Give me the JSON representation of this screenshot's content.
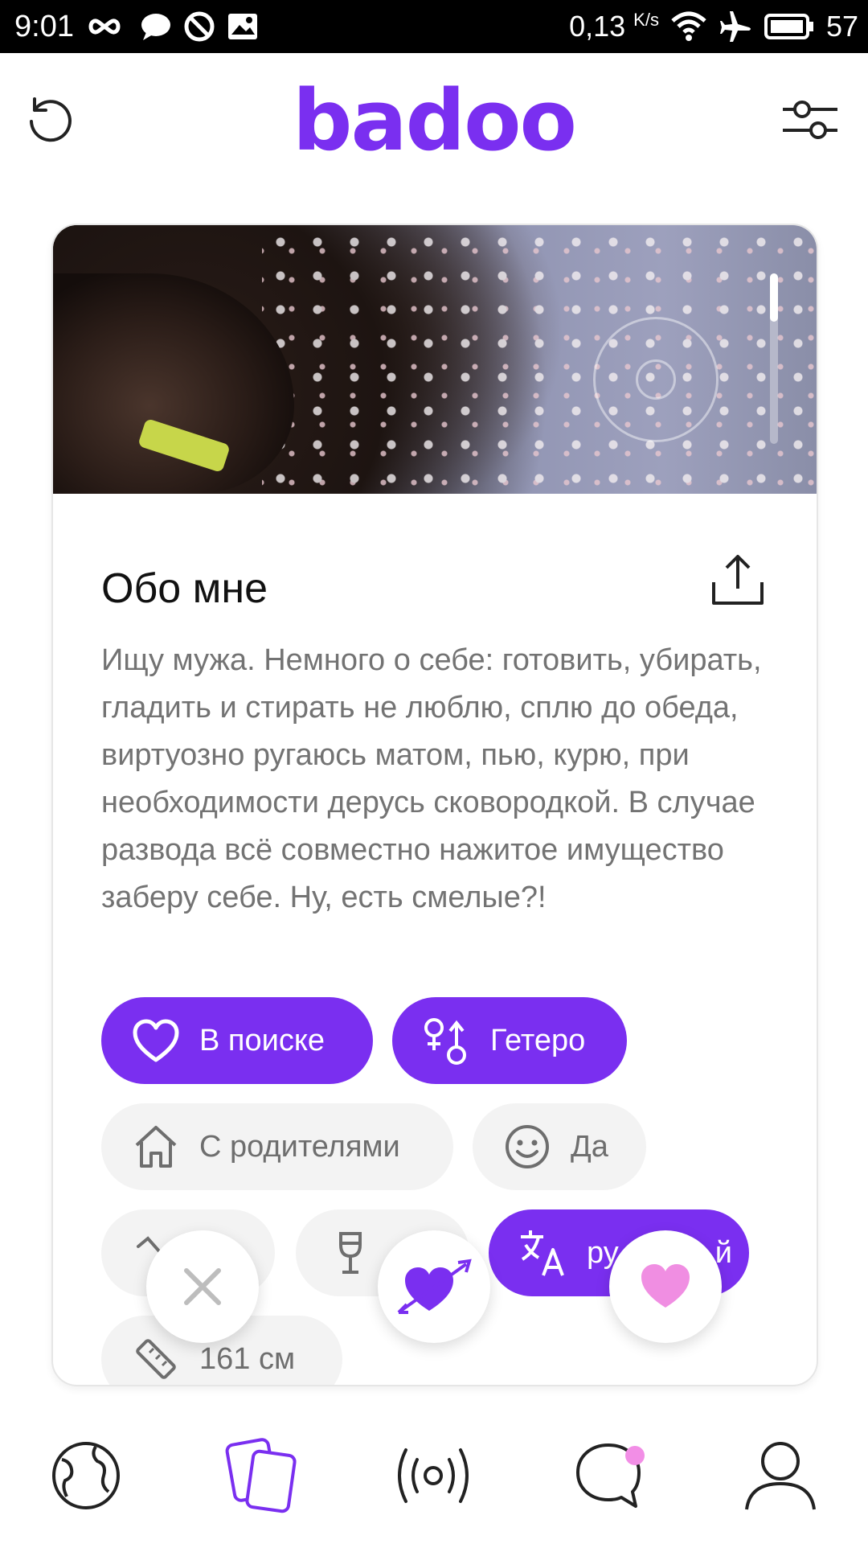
{
  "status_bar": {
    "time": "9:01",
    "speed": "0,13",
    "speed_unit": "K/s",
    "battery": "57",
    "icons": [
      "infinity-icon",
      "chat-bubble-icon",
      "do-not-disturb-icon",
      "gallery-icon",
      "wifi-icon",
      "airplane-icon",
      "battery-icon"
    ]
  },
  "header": {
    "logo": "badoo",
    "back_icon": "undo-icon",
    "filter_icon": "filter-sliders-icon"
  },
  "profile": {
    "about_title": "Обо мне",
    "about_text": "Ищу мужа. Немного о себе: готовить, убирать, гладить и стирать не люблю, сплю до обеда, виртуозно ругаюсь матом, пью, курю, при необходимости дерусь сковородкой. В случае развода всё совместно нажитое имущество заберу себе. Ну, есть смелые?!",
    "chips": {
      "looking": "В поиске",
      "orientation": "Гетеро",
      "living": "С родителями",
      "kids": "Да",
      "language": "ру",
      "language_tail": "й",
      "height": "161 см"
    }
  },
  "actions": {
    "dislike_icon": "close-icon",
    "crush_icon": "cupid-heart-icon",
    "like_icon": "heart-icon"
  },
  "nav": {
    "items": [
      "globe-icon",
      "cards-icon",
      "broadcast-icon",
      "chat-icon",
      "profile-icon"
    ],
    "active": "cards-icon"
  },
  "colors": {
    "brand": "#7a2ff0",
    "like": "#f08ee2",
    "muted_text": "#737373",
    "chip_grey": "#f3f3f3"
  }
}
